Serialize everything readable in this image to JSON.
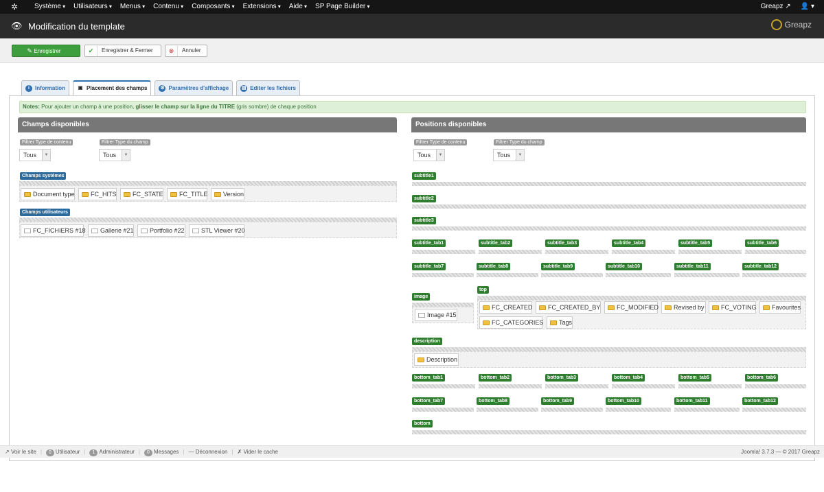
{
  "topbar": {
    "menu": [
      "Système",
      "Utilisateurs",
      "Menus",
      "Contenu",
      "Composants",
      "Extensions",
      "Aide",
      "SP Page Builder"
    ],
    "user": "Greapz",
    "user_icon": "user-icon",
    "external_icon": "external-link-icon"
  },
  "header": {
    "title": "Modification du template",
    "brand": "Greapz"
  },
  "toolbar": {
    "save": "Enregistrer",
    "save_close": "Enregistrer & Fermer",
    "cancel": "Annuler"
  },
  "tabs": [
    "Information",
    "Placement des champs",
    "Paramètres d'affichage",
    "Editer les fichiers"
  ],
  "note": {
    "prefix": "Notes:",
    "text1": " Pour ajouter un champ à une position, ",
    "bold": "glisser le champ sur la ligne du TITRE",
    "text2": " (gris sombre) de chaque position"
  },
  "left": {
    "title": "Champs disponibles",
    "filter1": "Filtrer Type de contenu",
    "filter2": "Filtrer Type du champ",
    "select1": "Tous",
    "select2": "Tous",
    "group1": "Champs systèmes",
    "group1_fields": [
      "Document type",
      "FC_HITS",
      "FC_STATE",
      "FC_TITLE",
      "Version"
    ],
    "group2": "Champs utilisateurs",
    "group2_fields": [
      "FC_FICHIERS #18",
      "Gallerie #21",
      "Portfolio #22",
      "STL Viewer #20"
    ]
  },
  "right": {
    "title": "Positions disponibles",
    "filter1": "Filtrer Type de contenu",
    "filter2": "Filtrer Type du champ",
    "select1": "Tous",
    "select2": "Tous",
    "subtitle1": "subtitle1",
    "subtitle2": "subtitle2",
    "subtitle3": "subtitle3",
    "subtitle_tabs_row1": [
      "subtitle_tab1",
      "subtitle_tab2",
      "subtitle_tab3",
      "subtitle_tab4",
      "subtitle_tab5",
      "subtitle_tab6"
    ],
    "subtitle_tabs_row2": [
      "subtitle_tab7",
      "subtitle_tab8",
      "subtitle_tab9",
      "subtitle_tab10",
      "subtitle_tab11",
      "subtitle_tab12"
    ],
    "image": "image",
    "image_field": "Image #15",
    "top": "top",
    "top_fields": [
      "FC_CREATED",
      "FC_CREATED_BY",
      "FC_MODIFIED",
      "Revised by",
      "FC_VOTING",
      "Favourites",
      "FC_CATEGORIES",
      "Tags"
    ],
    "description": "description",
    "description_field": "Description",
    "bottom_tabs_row1": [
      "bottom_tab1",
      "bottom_tab2",
      "bottom_tab3",
      "bottom_tab4",
      "bottom_tab5",
      "bottom_tab6"
    ],
    "bottom_tabs_row2": [
      "bottom_tab7",
      "bottom_tab8",
      "bottom_tab9",
      "bottom_tab10",
      "bottom_tab11",
      "bottom_tab12"
    ],
    "bottom": "bottom"
  },
  "footer": {
    "site": "Voir le site",
    "users_count": "0",
    "users": "Utilisateur",
    "admins_count": "1",
    "admins": "Administrateur",
    "messages_count": "0",
    "messages": "Messages",
    "logout": "Déconnexion",
    "cache": "Vider le cache",
    "version": "Joomla! 3.7.3 — © 2017 Greapz"
  }
}
